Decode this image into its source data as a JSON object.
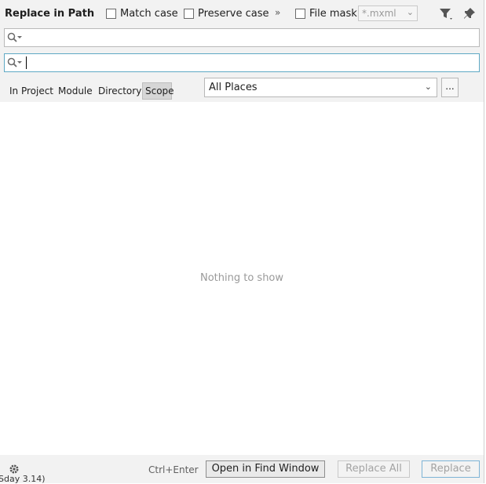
{
  "title": "Replace in Path",
  "options": {
    "match_case": "Match case",
    "preserve_case": "Preserve case",
    "more": "»",
    "file_mask_label": "File mask:",
    "file_mask_value": "*.mxml"
  },
  "search": {
    "find_value": "",
    "replace_value": ""
  },
  "scope_tabs": [
    "In Project",
    "Module",
    "Directory",
    "Scope"
  ],
  "scope_selected": "All Places",
  "scope_more": "...",
  "results": {
    "empty_text": "Nothing to show"
  },
  "footer": {
    "shortcut": "Ctrl+Enter",
    "open_in_find_window": "Open in Find Window",
    "replace_all": "Replace All",
    "replace": "Replace"
  },
  "background_text": "Sday 3.14)"
}
